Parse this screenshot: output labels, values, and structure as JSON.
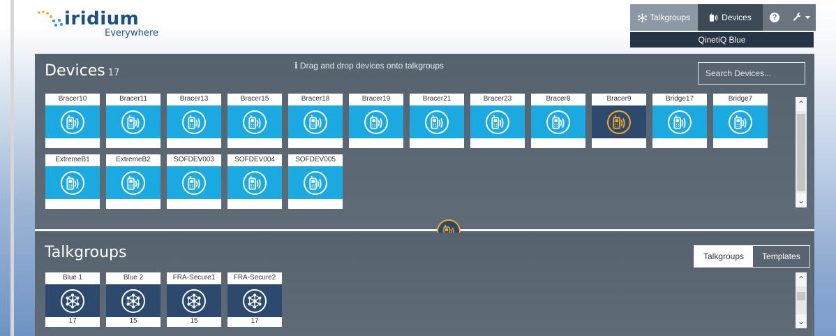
{
  "brand": {
    "name": "iridium",
    "tagline": "Everywhere"
  },
  "nav": {
    "talkgroups_label": "Talkgroups",
    "devices_label": "Devices",
    "help_label": "?",
    "organization": "QinetiQ Blue"
  },
  "devices_panel": {
    "title": "Devices",
    "count": "17",
    "hint": "Drag and drop devices onto talkgroups",
    "search_placeholder": "Search Devices...",
    "devices": [
      {
        "name": "Bracer10",
        "selected": false
      },
      {
        "name": "Bracer11",
        "selected": false
      },
      {
        "name": "Bracer13",
        "selected": false
      },
      {
        "name": "Bracer15",
        "selected": false
      },
      {
        "name": "Bracer18",
        "selected": false
      },
      {
        "name": "Bracer19",
        "selected": false
      },
      {
        "name": "Bracer21",
        "selected": false
      },
      {
        "name": "Bracer23",
        "selected": false
      },
      {
        "name": "Bracer8",
        "selected": false
      },
      {
        "name": "Bracer9",
        "selected": true
      },
      {
        "name": "Bridge17",
        "selected": false
      },
      {
        "name": "Bridge7",
        "selected": false
      },
      {
        "name": "ExtremeB1",
        "selected": false
      },
      {
        "name": "ExtremeB2",
        "selected": false
      },
      {
        "name": "SOFDEV003",
        "selected": false
      },
      {
        "name": "SOFDEV004",
        "selected": false
      },
      {
        "name": "SOFDEV005",
        "selected": false
      }
    ]
  },
  "talkgroups_panel": {
    "title": "Talkgroups",
    "tabs": [
      {
        "label": "Talkgroups",
        "active": true
      },
      {
        "label": "Templates",
        "active": false
      }
    ],
    "talkgroups": [
      {
        "name": "Blue 1",
        "count": "17"
      },
      {
        "name": "Blue 2",
        "count": "15"
      },
      {
        "name": "FRA-Secure1",
        "count": "15"
      },
      {
        "name": "FRA-Secure2",
        "count": "17"
      }
    ]
  },
  "colors": {
    "tile_blue": "#1aa9e1",
    "tile_navy": "#2d4a6e",
    "accent_orange": "#f7a823",
    "panel_slate": "#5d6a77"
  },
  "icons": {
    "device": "satellite-phone-icon",
    "talkgroup": "network-hub-icon"
  }
}
